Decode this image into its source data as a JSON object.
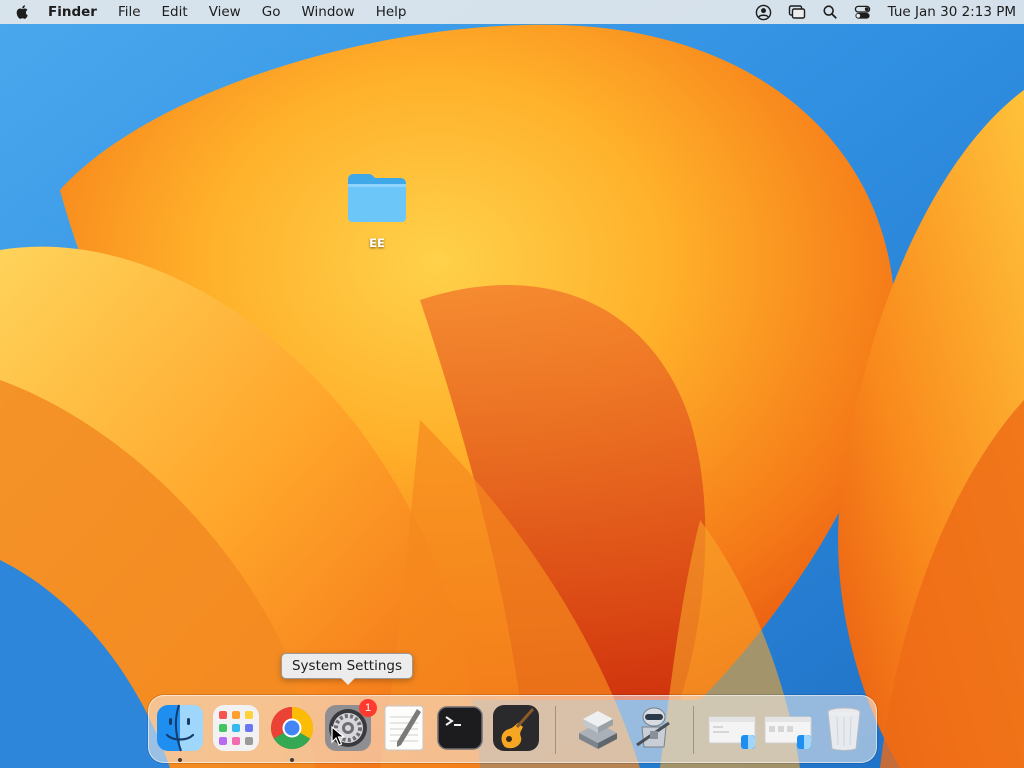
{
  "menubar": {
    "app_name": "Finder",
    "menus": [
      "File",
      "Edit",
      "View",
      "Go",
      "Window",
      "Help"
    ],
    "status_icons": [
      "user-icon",
      "screen-mirroring-icon",
      "search-icon",
      "control-center-icon"
    ],
    "clock": "Tue Jan 30  2:13 PM"
  },
  "desktop": {
    "items": [
      {
        "label": "EE",
        "icon": "folder-icon"
      }
    ]
  },
  "tooltip": {
    "text": "System Settings"
  },
  "dock": {
    "apps": [
      {
        "name": "Finder",
        "icon": "finder-icon",
        "running": true
      },
      {
        "name": "Launchpad",
        "icon": "launchpad-icon",
        "running": false
      },
      {
        "name": "Google Chrome",
        "icon": "chrome-icon",
        "running": true
      },
      {
        "name": "System Settings",
        "icon": "system-settings-icon",
        "running": false,
        "badge": "1"
      },
      {
        "name": "TextEdit",
        "icon": "textedit-icon",
        "running": false
      },
      {
        "name": "Terminal",
        "icon": "terminal-icon",
        "running": false
      },
      {
        "name": "GarageBand",
        "icon": "garageband-icon",
        "running": false
      },
      {
        "name": "Migration Assistant",
        "icon": "migration-assistant-icon",
        "running": false
      },
      {
        "name": "Automator",
        "icon": "automator-icon",
        "running": false
      },
      {
        "name": "Window 1",
        "icon": "minimized-window-icon",
        "running": false
      },
      {
        "name": "Window 2",
        "icon": "minimized-window-icon",
        "running": false
      },
      {
        "name": "Trash",
        "icon": "trash-icon",
        "running": false
      }
    ]
  },
  "colors": {
    "menubar_bg": "#ececec",
    "folder_blue": "#6cc6f8",
    "badge_red": "#ff3b30"
  }
}
